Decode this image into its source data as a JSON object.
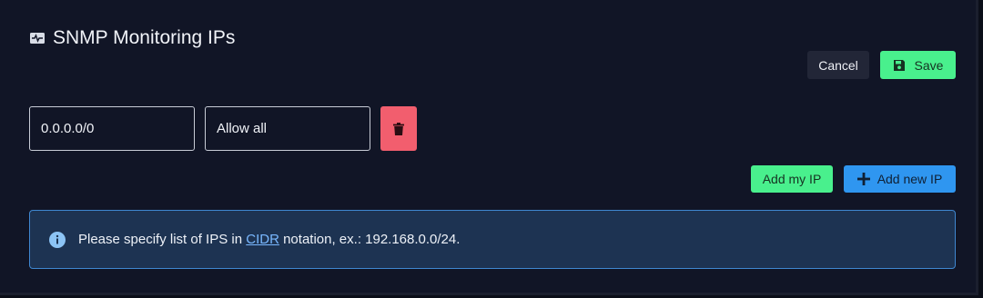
{
  "section": {
    "title": "SNMP Monitoring IPs",
    "title_icon": "network-monitor-icon"
  },
  "toolbar": {
    "cancel_label": "Cancel",
    "save_label": "Save",
    "save_icon": "floppy-disk-icon"
  },
  "ip_rows": [
    {
      "ip": "0.0.0.0/0",
      "description": "Allow all",
      "delete_icon": "trash-icon"
    }
  ],
  "actions": {
    "add_my_ip_label": "Add my IP",
    "add_new_ip_label": "Add new IP",
    "add_new_ip_icon": "plus-icon"
  },
  "notice": {
    "icon": "info-icon",
    "text_before": "Please specify list of IPS in ",
    "link_text": "CIDR",
    "text_after": " notation, ex.: 192.168.0.0/24."
  },
  "colors": {
    "background": "#111526",
    "success": "#49f08d",
    "danger": "#f25e6e",
    "primary": "#2f96f0",
    "info_bg": "#1d3352",
    "info_border": "#3f87d0"
  }
}
